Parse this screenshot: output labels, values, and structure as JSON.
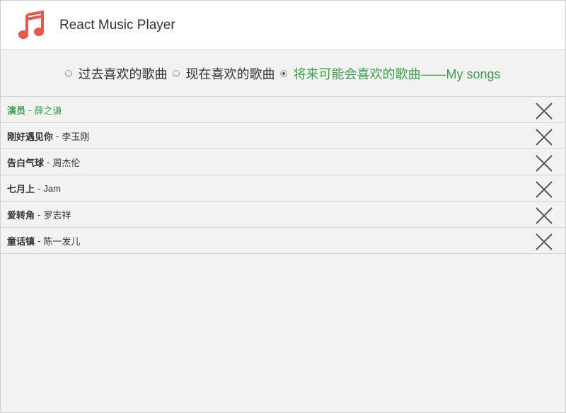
{
  "header": {
    "title": "React Music Player",
    "logo_icon": "music-note-icon",
    "accent_color": "#e8574a"
  },
  "filter": {
    "options": [
      {
        "label": "过去喜欢的歌曲",
        "checked": false
      },
      {
        "label": "现在喜欢的歌曲",
        "checked": false
      },
      {
        "label": "将来可能会喜欢的歌曲——My songs",
        "checked": true
      }
    ],
    "active_color": "#3aa14a"
  },
  "songs": [
    {
      "title": "演员",
      "separator": "-",
      "artist": "薛之谦",
      "current": true
    },
    {
      "title": "刚好遇见你",
      "separator": "-",
      "artist": "李玉刚",
      "current": false
    },
    {
      "title": "告白气球",
      "separator": "-",
      "artist": "周杰伦",
      "current": false
    },
    {
      "title": "七月上",
      "separator": "-",
      "artist": "Jam",
      "current": false
    },
    {
      "title": "爱转角",
      "separator": "-",
      "artist": "罗志祥",
      "current": false
    },
    {
      "title": "童话镇",
      "separator": "-",
      "artist": "陈一发儿",
      "current": false
    }
  ],
  "delete_icon": "close-icon"
}
